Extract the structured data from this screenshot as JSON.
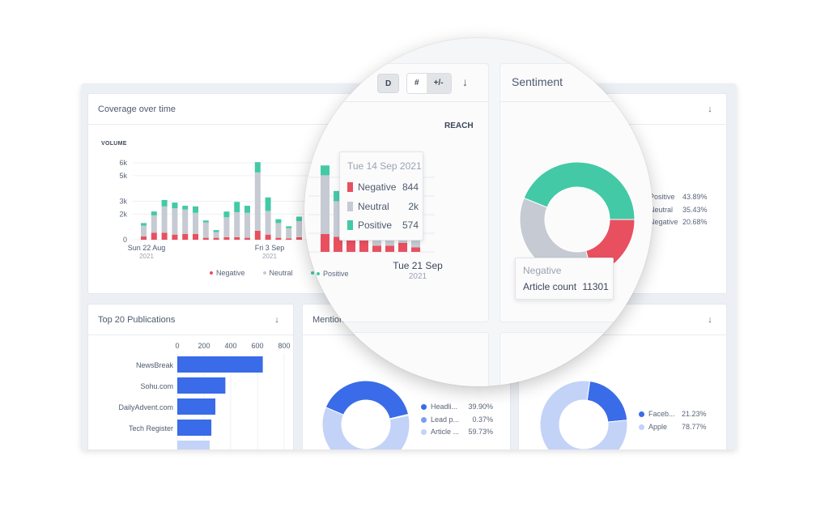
{
  "colors": {
    "negative": "#e8505f",
    "neutral": "#c6cad3",
    "positive": "#44c9a6",
    "blue_dark": "#3a6be8",
    "blue_mid": "#7a9df0",
    "blue_light": "#c3d2f7"
  },
  "coverage": {
    "title": "Coverage over time",
    "axis_title": "VOLUME",
    "legend": [
      "Negative",
      "Neutral",
      "Positive"
    ],
    "x_labels": [
      {
        "label": "Sun 22 Aug",
        "year": "2021"
      },
      {
        "label": "Fri 3 Sep",
        "year": "2021"
      }
    ]
  },
  "toolbar": {
    "d_label": "D",
    "count_label": "#",
    "delta_label": "+/-",
    "download_icon": "arrow-down-icon",
    "reach_label": "REACH"
  },
  "tooltip_coverage": {
    "date": "Tue 14 Sep 2021",
    "rows": [
      {
        "label": "Negative",
        "value": "844"
      },
      {
        "label": "Neutral",
        "value": "2k"
      },
      {
        "label": "Positive",
        "value": "574"
      }
    ]
  },
  "mag_x_label": {
    "label": "Tue 21 Sep",
    "year": "2021"
  },
  "sentiment": {
    "title": "Sentiment",
    "legend": [
      {
        "label": "Positive",
        "value": "43.89%"
      },
      {
        "label": "Neutral",
        "value": "35.43%"
      },
      {
        "label": "Negative",
        "value": "20.68%"
      }
    ],
    "tooltip": {
      "title": "Negative",
      "label": "Article count",
      "value": "11301"
    }
  },
  "publications": {
    "title": "Top 20 Publications",
    "ticks": [
      "0",
      "200",
      "400",
      "600",
      "800"
    ],
    "rows": [
      {
        "label": "NewsBreak"
      },
      {
        "label": "Sohu.com"
      },
      {
        "label": "DailyAdvent.com"
      },
      {
        "label": "Tech Register"
      }
    ]
  },
  "mention": {
    "title": "Mention position",
    "legend": [
      {
        "label": "Headli...",
        "value": "39.90%"
      },
      {
        "label": "Lead p...",
        "value": "0.37%"
      },
      {
        "label": "Article ...",
        "value": "59.73%"
      }
    ]
  },
  "social": {
    "legend": [
      {
        "label": "Faceb...",
        "value": "21.23%"
      },
      {
        "label": "Apple",
        "value": "78.77%"
      }
    ]
  },
  "chart_data": [
    {
      "type": "bar",
      "stacked": true,
      "title": "Coverage over time",
      "ylabel": "VOLUME",
      "yticks": [
        "0",
        "2k",
        "3k",
        "5k",
        "6k"
      ],
      "ylim": [
        0,
        6000
      ],
      "x_tick_labels": [
        "Sun 22 Aug 2021",
        "Fri 3 Sep 2021",
        "Tue 21 Sep 2021"
      ],
      "grid": true,
      "legend_position": "bottom",
      "series": [
        {
          "name": "Negative",
          "values": [
            250,
            550,
            550,
            400,
            450,
            450,
            150,
            150,
            200,
            200,
            150,
            700,
            400,
            150,
            100,
            200,
            300,
            350,
            1000,
            844,
            800,
            800,
            350,
            350,
            500,
            250
          ]
        },
        {
          "name": "Neutral",
          "values": [
            850,
            1350,
            2050,
            2050,
            1900,
            1650,
            1200,
            450,
            1550,
            1950,
            1950,
            4550,
            1850,
            1150,
            800,
            1250,
            1750,
            2100,
            3300,
            2000,
            1800,
            1500,
            1300,
            1400,
            1300,
            1200
          ]
        },
        {
          "name": "Positive",
          "values": [
            200,
            300,
            500,
            450,
            300,
            500,
            150,
            150,
            450,
            800,
            550,
            800,
            1050,
            300,
            150,
            350,
            400,
            450,
            550,
            574,
            700,
            600,
            500,
            500,
            400,
            400
          ]
        }
      ]
    },
    {
      "type": "pie",
      "title": "Sentiment",
      "donut": true,
      "categories": [
        "Positive",
        "Neutral",
        "Negative"
      ],
      "values": [
        43.89,
        35.43,
        20.68
      ],
      "legend_position": "right"
    },
    {
      "type": "bar",
      "orientation": "horizontal",
      "title": "Top 20 Publications",
      "categories": [
        "NewsBreak",
        "Sohu.com",
        "DailyAdvent.com",
        "Tech Register"
      ],
      "values": [
        640,
        360,
        285,
        255
      ],
      "xlim": [
        0,
        800
      ],
      "xticks": [
        0,
        200,
        400,
        600,
        800
      ],
      "grid": true
    },
    {
      "type": "pie",
      "title": "Mention position",
      "donut": true,
      "categories": [
        "Headli...",
        "Lead p...",
        "Article ..."
      ],
      "values": [
        39.9,
        0.37,
        59.73
      ],
      "legend_position": "right"
    },
    {
      "type": "pie",
      "donut": true,
      "categories": [
        "Faceb...",
        "Apple"
      ],
      "values": [
        21.23,
        78.77
      ],
      "legend_position": "right"
    }
  ]
}
